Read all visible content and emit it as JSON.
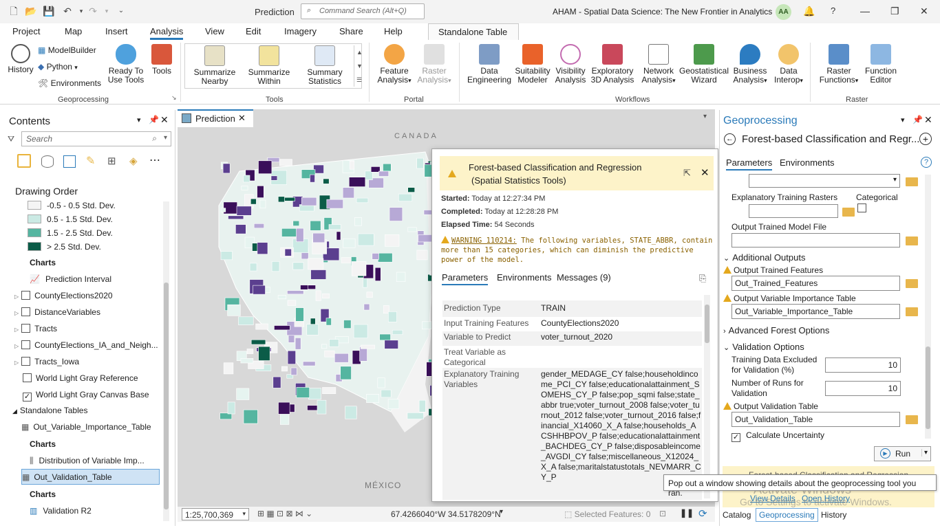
{
  "title_bar": {
    "doc_title": "Prediction",
    "command_search_placeholder": "Command Search (Alt+Q)",
    "app_title": "AHAM - Spatial Data Science:  The New Frontier in Analytics",
    "avatar_initials": "AA"
  },
  "ribbon_tabs": [
    "Project",
    "Map",
    "Insert",
    "Analysis",
    "View",
    "Edit",
    "Imagery",
    "Share",
    "Help",
    "Standalone Table"
  ],
  "ribbon": {
    "geoprocessing": {
      "history": "History",
      "modelbuilder": "ModelBuilder",
      "python": "Python",
      "environments": "Environments",
      "ready_to_use_1": "Ready To",
      "ready_to_use_2": "Use Tools",
      "tools": "Tools",
      "group": "Geoprocessing"
    },
    "tools": {
      "summarize_nearby_1": "Summarize",
      "summarize_nearby_2": "Nearby",
      "summarize_within_1": "Summarize",
      "summarize_within_2": "Within",
      "summary_statistics_1": "Summary",
      "summary_statistics_2": "Statistics",
      "group": "Tools"
    },
    "portal": {
      "feature_analysis_1": "Feature",
      "feature_analysis_2": "Analysis",
      "raster_analysis_1": "Raster",
      "raster_analysis_2": "Analysis",
      "group": "Portal"
    },
    "workflows": {
      "items": [
        {
          "l1": "Data",
          "l2": "Engineering"
        },
        {
          "l1": "Suitability",
          "l2": "Modeler"
        },
        {
          "l1": "Visibility",
          "l2": "Analysis"
        },
        {
          "l1": "Exploratory",
          "l2": "3D Analysis"
        },
        {
          "l1": "Network",
          "l2": "Analysis"
        },
        {
          "l1": "Geostatistical",
          "l2": "Wizard"
        },
        {
          "l1": "Business",
          "l2": "Analysis"
        },
        {
          "l1": "Data",
          "l2": "Interop"
        }
      ],
      "group": "Workflows"
    },
    "raster": {
      "raster_functions_1": "Raster",
      "raster_functions_2": "Functions",
      "function_editor_1": "Function",
      "function_editor_2": "Editor",
      "group": "Raster"
    }
  },
  "contents": {
    "title": "Contents",
    "search_placeholder": "Search",
    "drawing_order": "Drawing Order",
    "legend": [
      {
        "label": "-0.5 - 0.5 Std. Dev.",
        "color": "#f4f4f4"
      },
      {
        "label": "0.5 - 1.5 Std. Dev.",
        "color": "#cbeae4"
      },
      {
        "label": "1.5 - 2.5 Std. Dev.",
        "color": "#55b5a0"
      },
      {
        "label": "> 2.5 Std. Dev.",
        "color": "#0b5c48"
      }
    ],
    "charts_label": "Charts",
    "prediction_interval": "Prediction Interval",
    "layers": [
      {
        "label": "CountyElections2020",
        "checked": false
      },
      {
        "label": "DistanceVariables",
        "checked": false
      },
      {
        "label": "Tracts",
        "checked": false
      },
      {
        "label": "CountyElections_IA_and_Neigh...",
        "checked": false
      },
      {
        "label": "Tracts_Iowa",
        "checked": false
      },
      {
        "label": "World Light Gray Reference",
        "checked": false
      },
      {
        "label": "World Light Gray Canvas Base",
        "checked": true
      }
    ],
    "standalone_tables": "Standalone Tables",
    "table1": "Out_Variable_Importance_Table",
    "chart1": "Distribution of Variable Imp...",
    "table2": "Out_Validation_Table",
    "chart2": "Validation R2"
  },
  "map": {
    "tab": "Prediction",
    "canada": "CANADA",
    "mexico": "MÉXICO",
    "scale": "1:25,700,369",
    "coords": "67.4266040°W 34.5178209°N",
    "selected_features": "Selected Features: 0"
  },
  "popup": {
    "title_1": "Forest-based Classification and Regression",
    "title_2": "(Spatial Statistics Tools)",
    "started_label": "Started:",
    "started": "Today at 12:27:34 PM",
    "completed_label": "Completed:",
    "completed": "Today at 12:28:28 PM",
    "elapsed_label": "Elapsed Time:",
    "elapsed": "54 Seconds",
    "warning_code": "WARNING 110214:",
    "warning_text": "The following variables, STATE_ABBR, contain more than 15 categories, which can diminish the predictive power of the model.",
    "tabs": [
      "Parameters",
      "Environments",
      "Messages (9)"
    ],
    "params": [
      {
        "k": "Prediction Type",
        "v": "TRAIN"
      },
      {
        "k": "Input Training Features",
        "v": "CountyElections2020"
      },
      {
        "k": "Variable to Predict",
        "v": "voter_turnout_2020"
      },
      {
        "k": "Treat Variable as Categorical",
        "v": ""
      },
      {
        "k": "Explanatory Training Variables",
        "v": "gender_MEDAGE_CY false;householdincome_PCI_CY false;educationalattainment_SOMEHS_CY_P false;pop_sqmi false;state_abbr true;voter_turnout_2008 false;voter_turnout_2012 false;voter_turnout_2016 false;financial_X14060_X_A false;households_ACSHHBPOV_P false;educationalattainment_BACHDEG_CY_P false;disposableincome_AVGDI_CY false;miscellaneous_X12024_X_A false;maritalstatustotals_NEVMARR_CY_P"
      }
    ]
  },
  "geoprocessing": {
    "title": "Geoprocessing",
    "tool": "Forest-based Classification and Regr...",
    "tabs": [
      "Parameters",
      "Environments"
    ],
    "explanatory_rasters": "Explanatory Training Rasters",
    "categorical": "Categorical",
    "output_model": "Output Trained Model File",
    "additional_outputs": "Additional Outputs",
    "out_features_label": "Output Trained Features",
    "out_features": "Out_Trained_Features",
    "out_importance_label": "Output Variable Importance Table",
    "out_importance": "Out_Variable_Importance_Table",
    "advanced": "Advanced Forest Options",
    "validation": "Validation Options",
    "excluded_label": "Training Data Excluded for Validation (%)",
    "excluded": "10",
    "runs_label": "Number of Runs for Validation",
    "runs": "10",
    "out_validation_label": "Output  Validation Table",
    "out_validation": "Out_Validation_Table",
    "calc_uncertainty": "Calculate Uncertainty",
    "run": "Run",
    "status_tool": "Forest-based Classification and Regression",
    "view_details": "View Details",
    "open_history": "Open History",
    "watermark_1": "Activate Windows",
    "watermark_2": "Go to Settings to activate Windows."
  },
  "tooltip": "Pop out a window showing details about the geoprocessing tool you ran.",
  "bottom_tabs": [
    "Catalog",
    "Geoprocessing",
    "History"
  ]
}
